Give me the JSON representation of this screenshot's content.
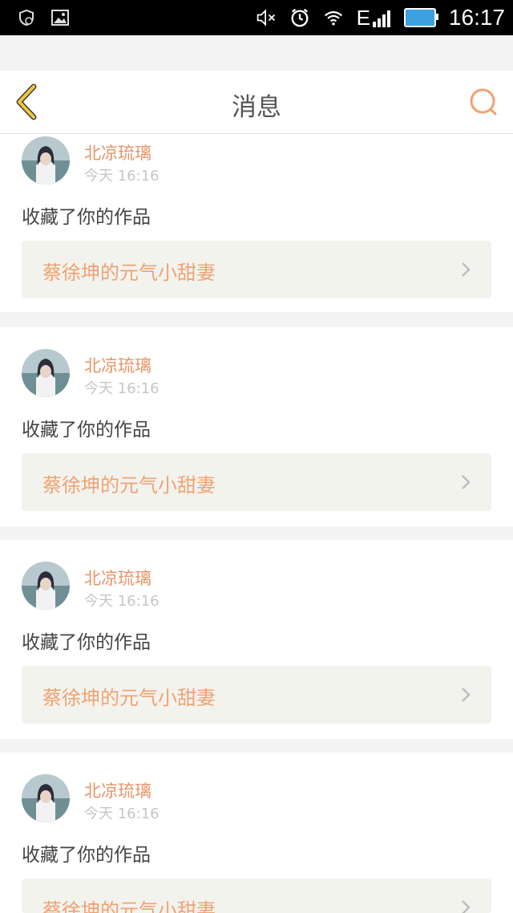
{
  "status_bar": {
    "time": "16:17",
    "network": "E",
    "icons": [
      "notification-shield-icon",
      "image-icon",
      "mute-icon",
      "alarm-icon",
      "wifi-icon",
      "signal-icon",
      "battery-icon"
    ]
  },
  "header": {
    "title": "消息",
    "back_icon": "chevron-left-icon",
    "search_icon": "search-icon"
  },
  "colors": {
    "accent_name": "#e89468",
    "accent_work": "#f0a272",
    "back_arrow": "#f0c63a",
    "search_icon": "#f0a272"
  },
  "messages": [
    {
      "username": "北凉琉璃",
      "time": "今天 16:16",
      "action": "收藏了你的作品",
      "work": "蔡徐坤的元气小甜妻"
    },
    {
      "username": "北凉琉璃",
      "time": "今天 16:16",
      "action": "收藏了你的作品",
      "work": "蔡徐坤的元气小甜妻"
    },
    {
      "username": "北凉琉璃",
      "time": "今天 16:16",
      "action": "收藏了你的作品",
      "work": "蔡徐坤的元气小甜妻"
    },
    {
      "username": "北凉琉璃",
      "time": "今天 16:16",
      "action": "收藏了你的作品",
      "work": "蔡徐坤的元气小甜妻"
    }
  ]
}
